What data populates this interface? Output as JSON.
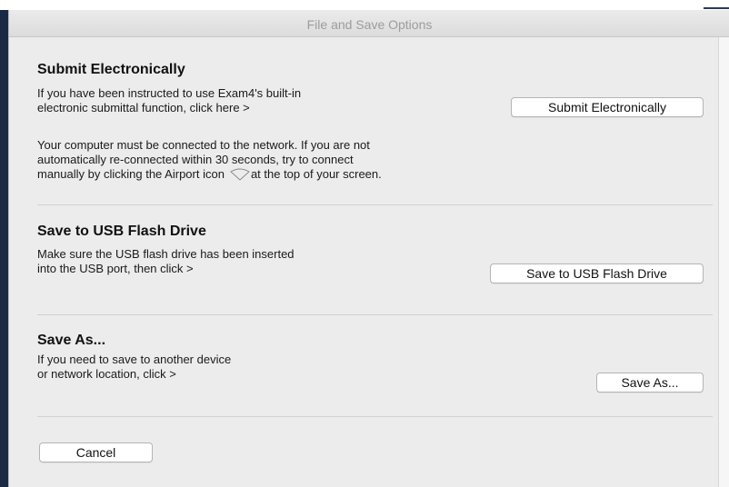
{
  "window": {
    "title": "File and Save Options"
  },
  "submit_section": {
    "heading": "Submit Electronically",
    "line1": "If you have been instructed to use Exam4's built-in",
    "line2": "electronic submittal function, click here >",
    "button_label": "Submit Electronically",
    "note_line1": "Your computer must be connected to the network. If you are not",
    "note_line2": "automatically re-connected within 30 seconds, try to connect",
    "note_line3a": "manually by clicking the Airport icon",
    "note_line3b": "at the top of your screen.",
    "icon": "wifi-icon"
  },
  "usb_section": {
    "heading": "Save to USB Flash Drive",
    "line1": "Make sure the USB flash drive has been inserted",
    "line2": "into the USB port, then click >",
    "button_label": "Save to USB Flash Drive"
  },
  "saveas_section": {
    "heading": "Save As...",
    "line1": "If you need to save to another device",
    "line2": "or network location, click >",
    "button_label": "Save As..."
  },
  "footer": {
    "cancel_label": "Cancel"
  },
  "colors": {
    "window_bg": "#ececec",
    "title_text": "#9c9c9c",
    "separator": "#d2d2d2"
  }
}
